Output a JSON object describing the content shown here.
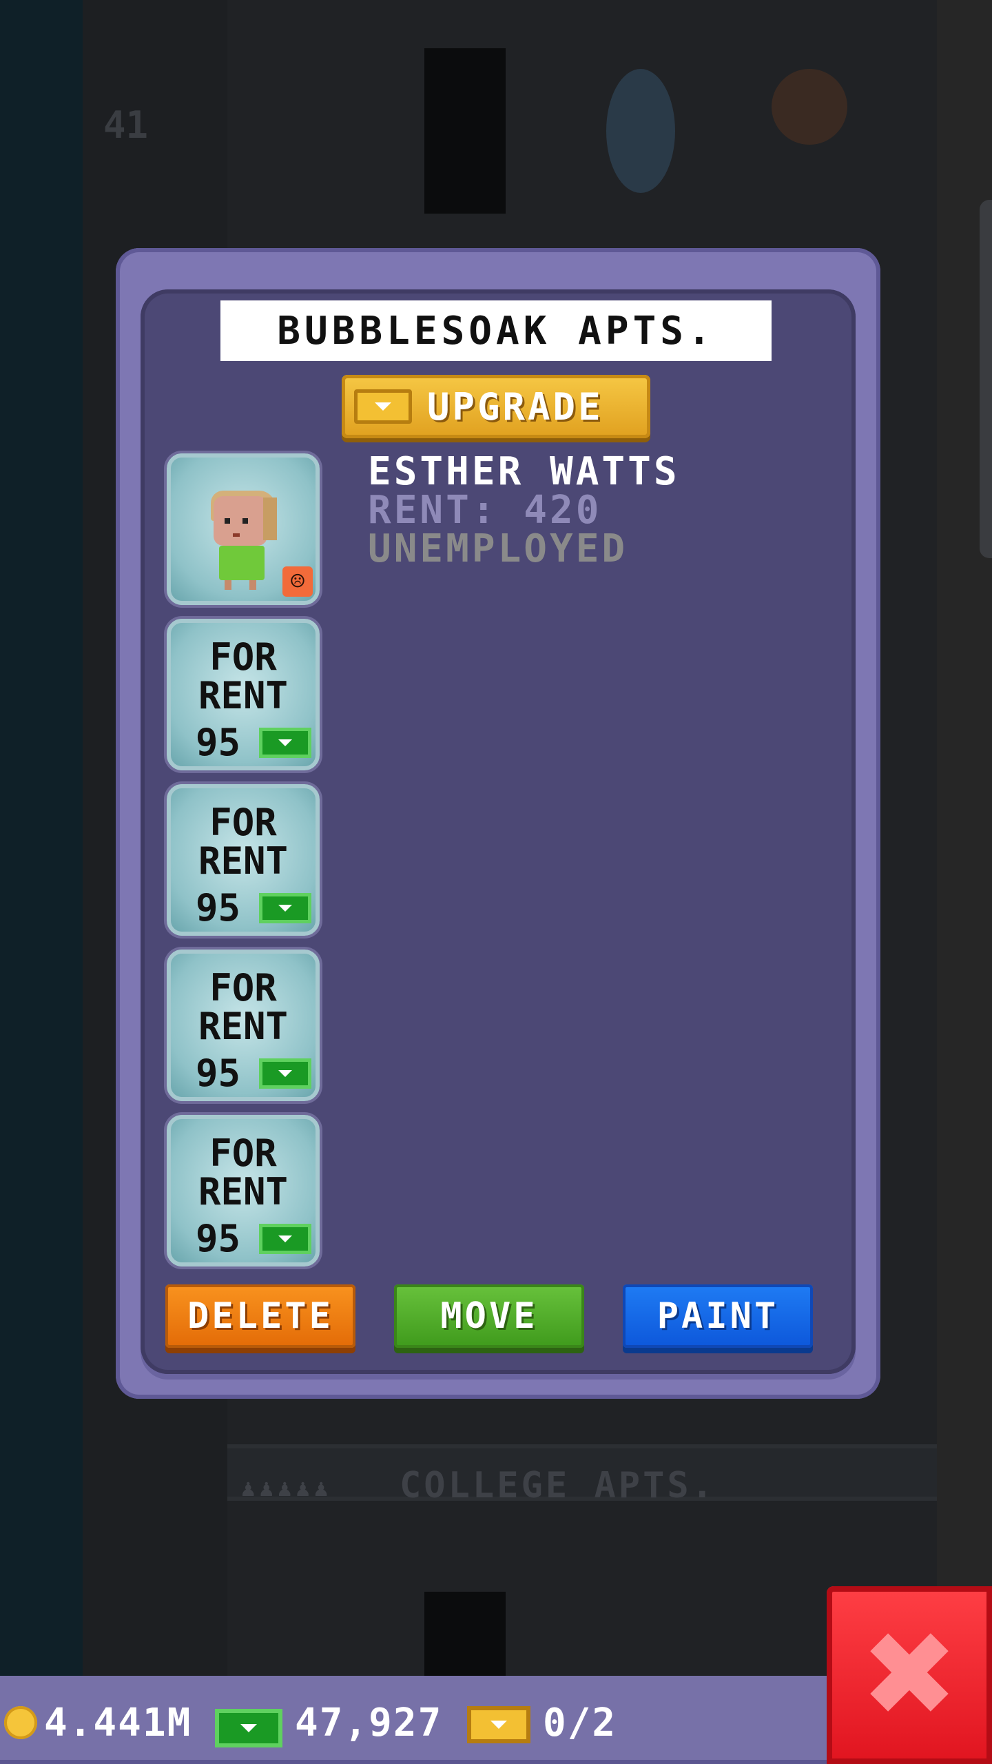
{
  "background": {
    "floor_number": "41",
    "floor_label": "COLLEGE APTS."
  },
  "dialog": {
    "title": "BUBBLESOAK APTS.",
    "upgrade_label": "UPGRADE",
    "resident": {
      "name": "ESTHER WATTS",
      "rent": "RENT: 420",
      "job": "UNEMPLOYED",
      "mood": "unhappy"
    },
    "vacant_slots": [
      {
        "line1": "FOR",
        "line2": "RENT",
        "cost": "95"
      },
      {
        "line1": "FOR",
        "line2": "RENT",
        "cost": "95"
      },
      {
        "line1": "FOR",
        "line2": "RENT",
        "cost": "95"
      },
      {
        "line1": "FOR",
        "line2": "RENT",
        "cost": "95"
      }
    ],
    "buttons": {
      "delete": "DELETE",
      "move": "MOVE",
      "paint": "PAINT"
    }
  },
  "status_bar": {
    "coins": "4.441M",
    "cash": "47,927",
    "bux": "0/2"
  },
  "icons": {
    "coin": "coin-icon",
    "cash": "cash-icon",
    "bux": "tower-bux-icon",
    "close": "close-icon",
    "mood": "sad-face-icon"
  },
  "colors": {
    "dialog_frame": "#7e77b3",
    "dialog_inner": "#4c4875",
    "delete": "#f07f14",
    "move": "#52ae2b",
    "paint": "#1469e8",
    "close": "#f0222b",
    "upgrade": "#f0b832"
  }
}
